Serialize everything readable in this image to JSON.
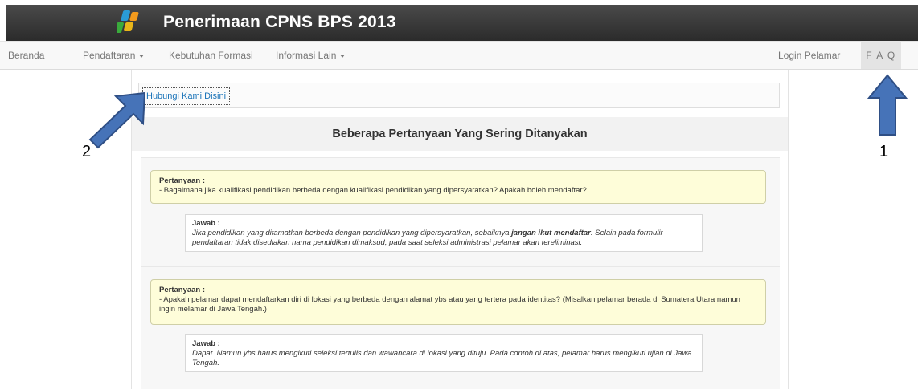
{
  "header": {
    "title": "Penerimaan CPNS BPS 2013",
    "logo_icon": "bps-logo-icon"
  },
  "nav": {
    "beranda": "Beranda",
    "pendaftaran": "Pendaftaran",
    "kebutuhan": "Kebutuhan Formasi",
    "informasi": "Informasi Lain",
    "login": "Login Pelamar",
    "faq": "F A Q"
  },
  "contact": {
    "link_label": "Hubungi Kami Disini"
  },
  "faq": {
    "heading": "Beberapa Pertanyaan Yang Sering Ditanyakan",
    "items": [
      {
        "q_label": "Pertanyaan :",
        "q_text": "- Bagaimana jika kualifikasi pendidikan berbeda dengan kualifikasi pendidikan yang dipersyaratkan? Apakah boleh mendaftar?",
        "a_label": "Jawab :",
        "a_text_before": "Jika pendidikan yang ditamatkan berbeda dengan pendidikan yang dipersyaratkan, sebaiknya ",
        "a_text_bold": "jangan ikut mendaftar",
        "a_text_after": ". Selain pada formulir pendaftaran tidak disediakan nama pendidikan dimaksud, pada saat seleksi administrasi pelamar akan tereliminasi."
      },
      {
        "q_label": "Pertanyaan :",
        "q_text": "- Apakah pelamar dapat mendaftarkan diri di lokasi yang berbeda dengan alamat ybs atau yang tertera pada identitas? (Misalkan pelamar berada di Sumatera Utara namun ingin melamar di Jawa Tengah.)",
        "a_label": "Jawab :",
        "a_text": "Dapat. Namun ybs harus mengikuti seleksi tertulis dan wawancara di lokasi yang dituju. Pada contoh di atas, pelamar harus mengikuti ujian di Jawa Tengah."
      }
    ]
  },
  "annotations": {
    "callout_1": "1",
    "callout_2": "2",
    "arrow_color": "#3f6bb0"
  },
  "colors": {
    "header_bg": "#2b2b2b",
    "link": "#1a73b8",
    "question_bg": "#fefdd9"
  }
}
